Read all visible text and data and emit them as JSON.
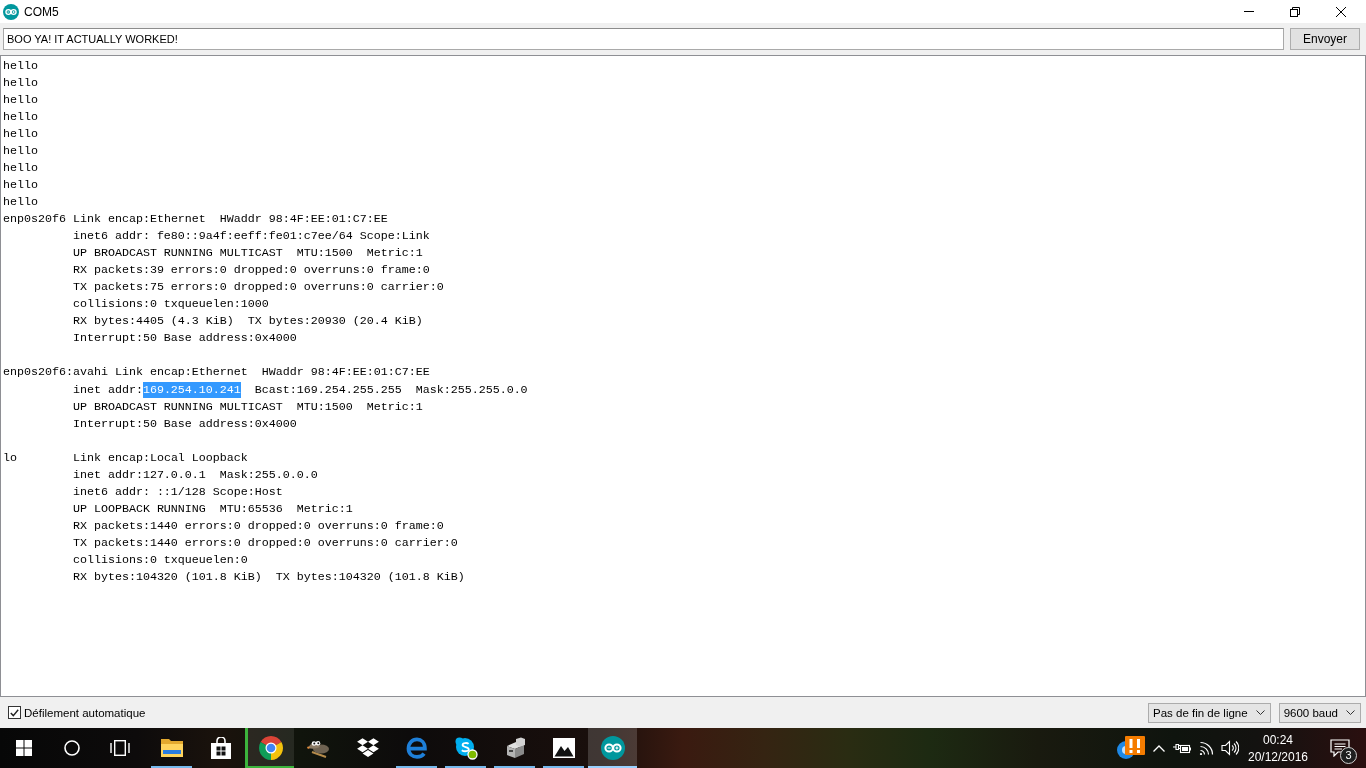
{
  "window": {
    "title": "COM5"
  },
  "send_bar": {
    "input": {
      "value": "BOO YA! IT ACTUALLY WORKED!"
    },
    "button": "Envoyer"
  },
  "console": {
    "messages": [
      "hello",
      "hello",
      "hello",
      "hello",
      "hello",
      "hello",
      "hello",
      "hello",
      "hello"
    ],
    "interfaces": [
      {
        "header": "enp0s20f6 Link encap:Ethernet  HWaddr 98:4F:EE:01:C7:EE",
        "details": [
          {
            "kind": "text",
            "text": "inet6 addr: fe80::9a4f:eeff:fe01:c7ee/64 Scope:Link"
          },
          {
            "kind": "text",
            "text": "UP BROADCAST RUNNING MULTICAST  MTU:1500  Metric:1"
          },
          {
            "kind": "text",
            "text": "RX packets:39 errors:0 dropped:0 overruns:0 frame:0"
          },
          {
            "kind": "text",
            "text": "TX packets:75 errors:0 dropped:0 overruns:0 carrier:0"
          },
          {
            "kind": "text",
            "text": "collisions:0 txqueuelen:1000"
          },
          {
            "kind": "text",
            "text": "RX bytes:4405 (4.3 KiB)  TX bytes:20930 (20.4 KiB)"
          },
          {
            "kind": "text",
            "text": "Interrupt:50 Base address:0x4000"
          }
        ]
      },
      {
        "header": "enp0s20f6:avahi Link encap:Ethernet  HWaddr 98:4F:EE:01:C7:EE",
        "details": [
          {
            "kind": "selection",
            "segments": [
              {
                "text": "inet addr:",
                "selected": false
              },
              {
                "text": "169.254.10.241",
                "selected": true
              },
              {
                "text": "  Bcast:169.254.255.255  Mask:255.255.0.0",
                "selected": false
              }
            ]
          },
          {
            "kind": "text",
            "text": "UP BROADCAST RUNNING MULTICAST  MTU:1500  Metric:1"
          },
          {
            "kind": "text",
            "text": "Interrupt:50 Base address:0x4000"
          }
        ]
      },
      {
        "header": "lo        Link encap:Local Loopback",
        "details": [
          {
            "kind": "text",
            "text": "inet addr:127.0.0.1  Mask:255.0.0.0"
          },
          {
            "kind": "text",
            "text": "inet6 addr: ::1/128 Scope:Host"
          },
          {
            "kind": "text",
            "text": "UP LOOPBACK RUNNING  MTU:65536  Metric:1"
          },
          {
            "kind": "text",
            "text": "RX packets:1440 errors:0 dropped:0 overruns:0 frame:0"
          },
          {
            "kind": "text",
            "text": "TX packets:1440 errors:0 dropped:0 overruns:0 carrier:0"
          },
          {
            "kind": "text",
            "text": "collisions:0 txqueuelen:0"
          },
          {
            "kind": "text",
            "text": "RX bytes:104320 (101.8 KiB)  TX bytes:104320 (101.8 KiB)"
          }
        ]
      }
    ]
  },
  "status_bar": {
    "autoscroll": {
      "label": "Défilement automatique",
      "checked": true
    },
    "line_ending": "Pas de fin de ligne",
    "baud_rate": "9600 baud"
  },
  "taskbar": {
    "apps": [
      {
        "running": true,
        "selected": false,
        "highlighted": false
      },
      {
        "running": false,
        "selected": false,
        "highlighted": false
      },
      {
        "running": true,
        "selected": false,
        "highlighted": true
      },
      {
        "running": false,
        "selected": false,
        "highlighted": false
      },
      {
        "running": false,
        "selected": false,
        "highlighted": false
      },
      {
        "running": true,
        "selected": false,
        "highlighted": false
      },
      {
        "running": true,
        "selected": false,
        "highlighted": false
      },
      {
        "running": true,
        "selected": false,
        "highlighted": false
      },
      {
        "running": true,
        "selected": false,
        "highlighted": false
      },
      {
        "running": true,
        "selected": true,
        "highlighted": false
      }
    ],
    "clock": {
      "time": "00:24",
      "date": "20/12/2016"
    },
    "notifications": {
      "count": "3"
    }
  }
}
